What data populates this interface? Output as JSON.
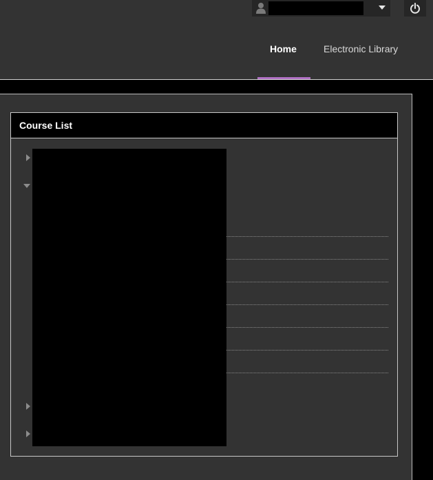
{
  "header": {
    "user_menu": {
      "avatar_icon": "user-silhouette-icon",
      "caret_icon": "caret-down-icon",
      "user_name": ""
    },
    "logout_icon": "power-icon",
    "tabs": [
      {
        "label": "Home",
        "active": true
      },
      {
        "label": "Electronic Library",
        "active": false
      }
    ],
    "accent_color": "#b070c4"
  },
  "course_list": {
    "title": "Course List",
    "expander_icons": [
      "triangle-right-icon",
      "triangle-down-icon",
      "triangle-right-icon",
      "triangle-right-icon"
    ]
  },
  "colors": {
    "page_background": "#000000",
    "panel_background": "#333333",
    "module_header_background": "#000000",
    "redaction": "#000000"
  }
}
